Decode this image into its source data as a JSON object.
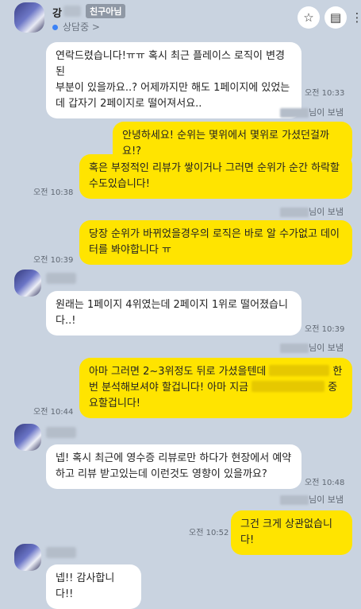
{
  "header": {
    "name": "강",
    "badge": "친구아님",
    "status": "상담중 >",
    "star_icon": "☆",
    "menu_icon": "▤",
    "more_icon": "⋮"
  },
  "messages": [
    {
      "lines": [
        "연락드렸습니다!ㅠㅠ 혹시 최근 플레이스 로직이 변경된",
        "부분이 있을까요..? 어제까지만 해도 1페이지에 있었는",
        "데 갑자기 2페이지로 떨어져서요.."
      ],
      "time": "오전 10:33"
    },
    {
      "sender_suffix": "님이 보냄"
    },
    {
      "lines": [
        "안녕하세요! 순위는 몇위에서 몇위로 가셨던걸까요!?"
      ]
    },
    {
      "lines": [
        "혹은 부정적인 리뷰가 쌓이거나 그러면 순위가 순간 하락할",
        "수도있습니다!"
      ],
      "time": "오전 10:38"
    },
    {
      "sender_suffix": "님이 보냄"
    },
    {
      "lines": [
        "당장 순위가 바뀌었을경우의 로직은 바로 알 수가없고 데이",
        "터를 봐야합니다 ㅠ"
      ],
      "time": "오전 10:39"
    },
    {
      "lines": [
        "원래는 1페이지 4위였는데 2페이지 1위로 떨어졌습니",
        "다..!"
      ],
      "time": "오전 10:39"
    },
    {
      "sender_suffix": "님이 보냄"
    },
    {
      "line1_a": "아마 그러면 2~3위정도 뒤로 가셨을텐데",
      "line1_b": "한",
      "line2": "번 분석해보셔야 할겁니다! 아마 지금",
      "line2_b": "중",
      "line3": "요할겁니다!",
      "time": "오전 10:44"
    },
    {
      "lines": [
        "넵! 혹시 최근에 영수증 리뷰로만 하다가 현장에서 예약",
        "하고 리뷰 받고있는데 이런것도 영향이 있을까요?"
      ],
      "time": "오전 10:48"
    },
    {
      "sender_suffix": "님이 보냄"
    },
    {
      "lines": [
        "그건 크게 상관없습니다!"
      ],
      "time": "오전 10:52"
    },
    {
      "lines": [
        "넵!! 감사합니다!!"
      ]
    }
  ]
}
